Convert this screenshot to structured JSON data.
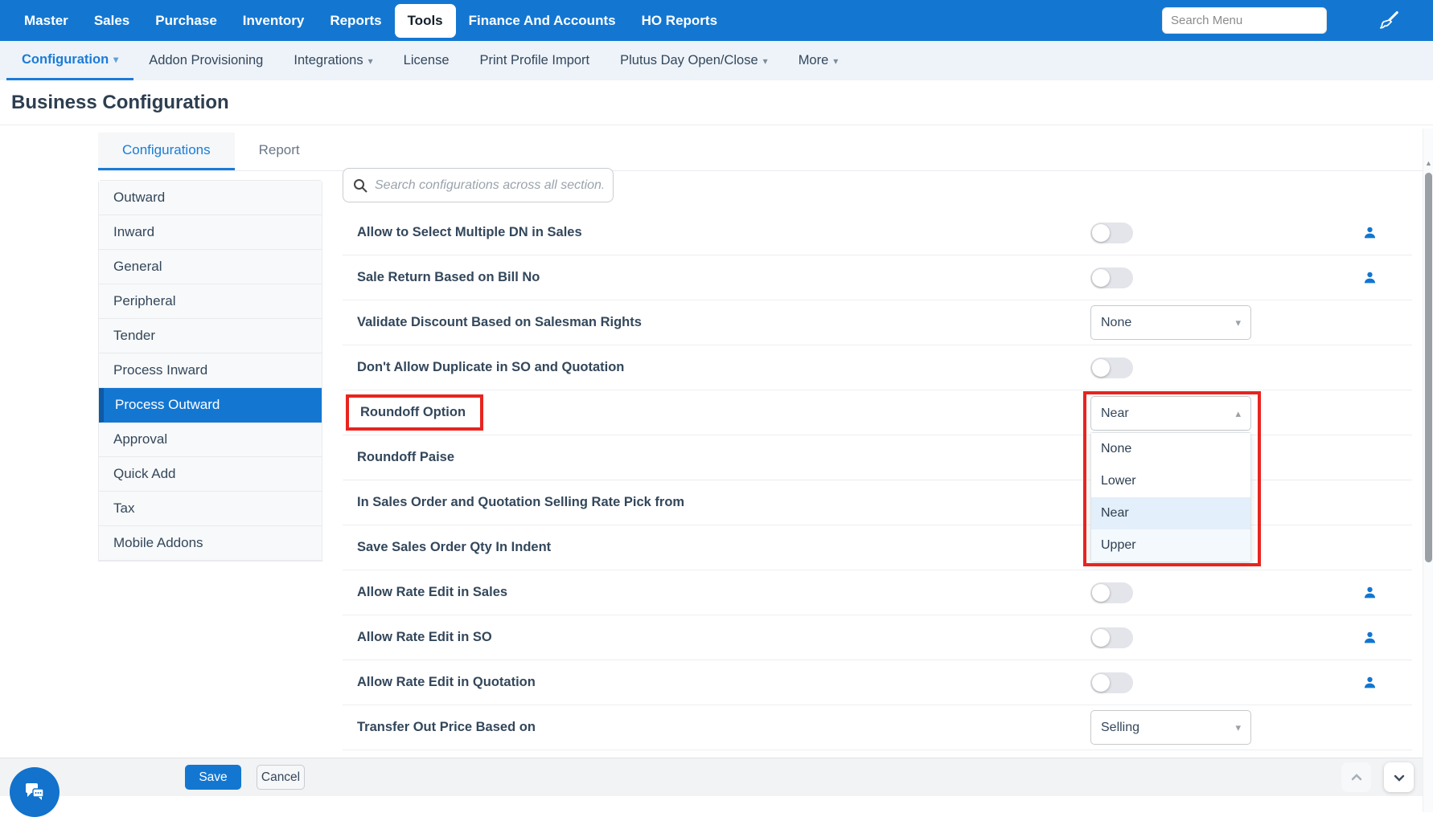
{
  "topnav": {
    "items": [
      {
        "label": "Master",
        "active": false
      },
      {
        "label": "Sales",
        "active": false
      },
      {
        "label": "Purchase",
        "active": false
      },
      {
        "label": "Inventory",
        "active": false
      },
      {
        "label": "Reports",
        "active": false
      },
      {
        "label": "Tools",
        "active": true
      },
      {
        "label": "Finance And Accounts",
        "active": false
      },
      {
        "label": "HO Reports",
        "active": false
      }
    ],
    "search": {
      "placeholder": "Search Menu",
      "value": ""
    },
    "icons": {
      "right_icon": "paint-brush-icon"
    }
  },
  "subnav": {
    "items": [
      {
        "label": "Configuration",
        "caret": true,
        "active": true
      },
      {
        "label": "Addon Provisioning",
        "caret": false,
        "active": false
      },
      {
        "label": "Integrations",
        "caret": true,
        "active": false
      },
      {
        "label": "License",
        "caret": false,
        "active": false
      },
      {
        "label": "Print Profile Import",
        "caret": false,
        "active": false
      },
      {
        "label": "Plutus Day Open/Close",
        "caret": true,
        "active": false
      },
      {
        "label": "More",
        "caret": true,
        "active": false
      }
    ]
  },
  "page_title": "Business Configuration",
  "tabs": [
    {
      "label": "Configurations",
      "active": true
    },
    {
      "label": "Report",
      "active": false
    }
  ],
  "sidebar": {
    "items": [
      {
        "label": "Outward",
        "active": false
      },
      {
        "label": "Inward",
        "active": false
      },
      {
        "label": "General",
        "active": false
      },
      {
        "label": "Peripheral",
        "active": false
      },
      {
        "label": "Tender",
        "active": false
      },
      {
        "label": "Process Inward",
        "active": false
      },
      {
        "label": "Process Outward",
        "active": true
      },
      {
        "label": "Approval",
        "active": false
      },
      {
        "label": "Quick Add",
        "active": false
      },
      {
        "label": "Tax",
        "active": false
      },
      {
        "label": "Mobile Addons",
        "active": false
      }
    ]
  },
  "settings": {
    "search": {
      "placeholder": "Search configurations across all section.",
      "value": ""
    },
    "rows": [
      {
        "label": "Allow to Select Multiple DN in Sales",
        "control": "toggle",
        "state": "off",
        "user_icon": true
      },
      {
        "label": "Sale Return Based on Bill No",
        "control": "toggle",
        "state": "off",
        "user_icon": true
      },
      {
        "label": "Validate Discount Based on Salesman Rights",
        "control": "select",
        "value": "None",
        "user_icon": false
      },
      {
        "label": "Don't Allow Duplicate in SO and Quotation",
        "control": "toggle",
        "state": "off",
        "user_icon": false
      },
      {
        "label": "Roundoff Option",
        "control": "select-open",
        "value": "Near",
        "highlighted": true,
        "user_icon": false
      },
      {
        "label": "Roundoff Paise",
        "control": "hidden-behind-menu",
        "user_icon": false
      },
      {
        "label": "In Sales Order and Quotation Selling Rate Pick from",
        "control": "hidden-behind-menu",
        "user_icon": false
      },
      {
        "label": "Save Sales Order Qty In Indent",
        "control": "hidden-behind-menu",
        "user_icon": false
      },
      {
        "label": "Allow Rate Edit in Sales",
        "control": "toggle",
        "state": "off",
        "user_icon": true
      },
      {
        "label": "Allow Rate Edit in SO",
        "control": "toggle",
        "state": "off",
        "user_icon": true
      },
      {
        "label": "Allow Rate Edit in Quotation",
        "control": "toggle",
        "state": "off",
        "user_icon": true
      },
      {
        "label": "Transfer Out Price Based on",
        "control": "select",
        "value": "Selling",
        "user_icon": false
      }
    ],
    "roundoff_dropdown": {
      "value": "Near",
      "options": [
        "None",
        "Lower",
        "Near",
        "Upper"
      ],
      "selected": "Near",
      "hovered": "Upper"
    }
  },
  "footer": {
    "save_label": "Save",
    "cancel_label": "Cancel"
  },
  "icons": [
    "search-icon",
    "magnifier-icon",
    "paint-brush-icon",
    "user-icon",
    "chat-icon",
    "chevron-up-icon",
    "chevron-down-icon",
    "caret-down-icon",
    "caret-up-icon"
  ],
  "colors": {
    "navbar_blue": "#1377d2",
    "link_blue": "#1a7cd7",
    "active_sidebar_blue": "#1377d2",
    "active_sidebar_edge": "#0d5aa7",
    "highlight_red": "#e8241f",
    "selected_option_bg": "#e3effa",
    "toggle_track": "#e3e5ea",
    "user_icon_blue": "#1276d1",
    "save_button": "#1377d2",
    "footer_bg": "#f2f3f5",
    "subnav_bg": "#eef3fa",
    "text_dark": "#33475b"
  }
}
